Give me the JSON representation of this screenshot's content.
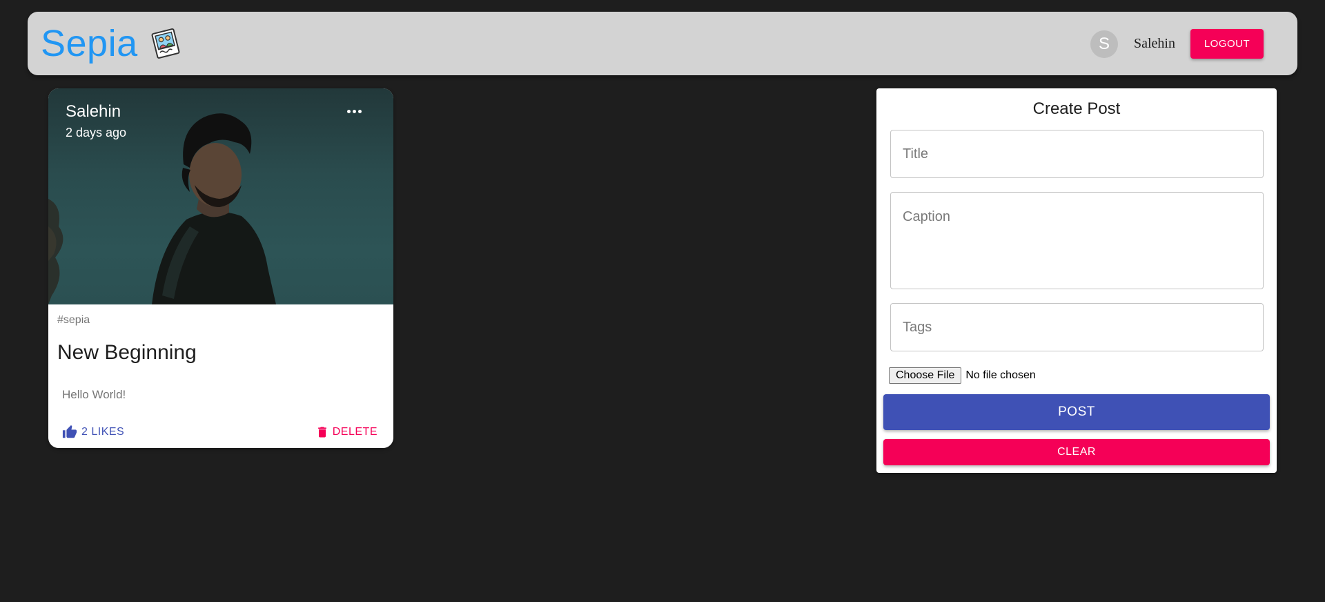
{
  "app": {
    "brand_title": "Sepia",
    "brand_logo_icon": "photo-memories-icon",
    "accent_color": "#2196f3"
  },
  "user": {
    "avatar_initial": "S",
    "name": "Salehin",
    "logout_label": "LOGOUT"
  },
  "posts": [
    {
      "author": "Salehin",
      "time_ago": "2 days ago",
      "tags": "#sepia",
      "title": "New Beginning",
      "message": "Hello World!",
      "like_label": "2 LIKES",
      "delete_label": "DELETE",
      "more_icon": "more-horizontal-icon",
      "like_icon": "thumb-up-icon",
      "delete_icon": "trash-icon"
    }
  ],
  "form": {
    "heading": "Create Post",
    "title_placeholder": "Title",
    "caption_placeholder": "Caption",
    "tags_placeholder": "Tags",
    "file_button_label": "Choose File",
    "file_status": "No file chosen",
    "submit_label": "POST",
    "clear_label": "CLEAR"
  },
  "colors": {
    "background": "#1e1e1e",
    "appbar": "#d3d3d3",
    "primary": "#3f51b5",
    "secondary": "#f50057"
  }
}
